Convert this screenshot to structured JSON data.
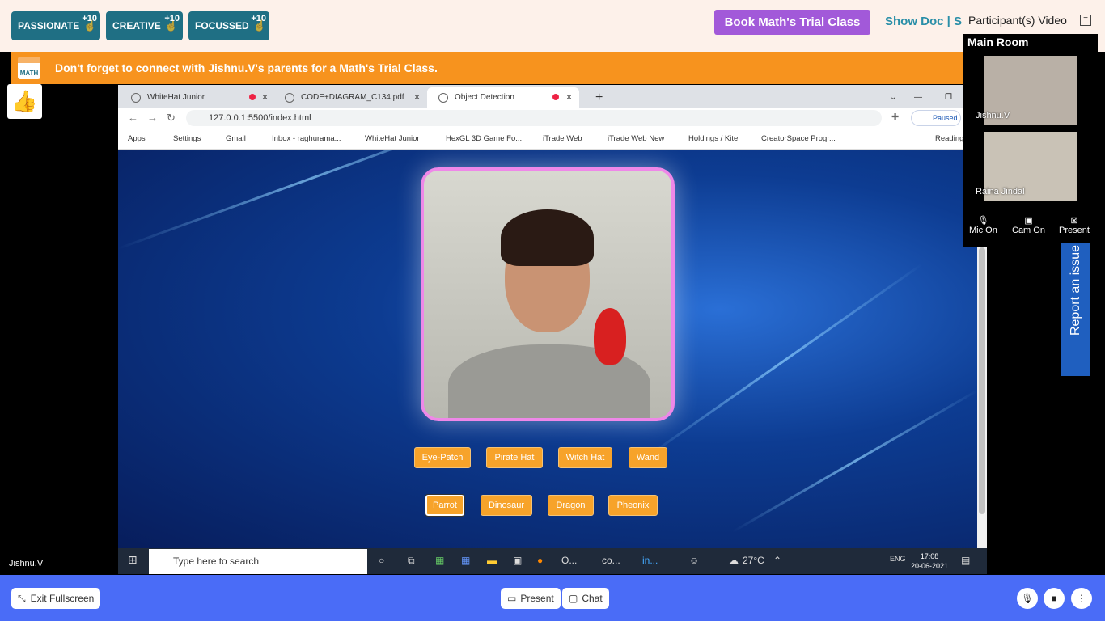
{
  "badges": [
    {
      "label": "PASSIONATE",
      "plus": "+10"
    },
    {
      "label": "CREATIVE",
      "plus": "+10"
    },
    {
      "label": "FOCUSSED",
      "plus": "+10"
    }
  ],
  "book_button": "Book Math's Trial Class",
  "show_doc": "Show Doc  |  S",
  "banner": {
    "logo": "MATH",
    "text": "Don't forget to connect with Jishnu.V's parents for a Math's Trial Class."
  },
  "browser": {
    "tabs": [
      {
        "title": "WhiteHat Junior"
      },
      {
        "title": "CODE+DIAGRAM_C134.pdf"
      },
      {
        "title": "Object Detection"
      }
    ],
    "url": "127.0.0.1:5500/index.html",
    "profile_status": "Paused",
    "bookmarks": [
      "Apps",
      "Settings",
      "Gmail",
      "Inbox - raghurama...",
      "WhiteHat Junior",
      "HexGL 3D Game Fo...",
      "iTrade Web",
      "iTrade Web New",
      "Holdings / Kite",
      "CreatorSpace Progr...",
      "Reading"
    ]
  },
  "app": {
    "row1": [
      "Eye-Patch",
      "Pirate Hat",
      "Witch Hat",
      "Wand"
    ],
    "row2": [
      "Parrot",
      "Dinosaur",
      "Dragon",
      "Pheonix"
    ]
  },
  "taskbar": {
    "search": "Type here to search",
    "apps": [
      "O...",
      "co...",
      "in..."
    ],
    "weather": "27°C",
    "lang": "ENG",
    "time": "17:08",
    "date": "20-06-2021"
  },
  "participants": {
    "title": "Participant(s) Video",
    "room": "Main Room",
    "people": [
      "Jishnu.V",
      "Raina Jindal"
    ],
    "controls": [
      "Mic On",
      "Cam On",
      "Present"
    ]
  },
  "report": "Report an issue",
  "user_label": "Jishnu.V",
  "bottom": {
    "exit": "Exit Fullscreen",
    "present": "Present",
    "chat": "Chat"
  }
}
